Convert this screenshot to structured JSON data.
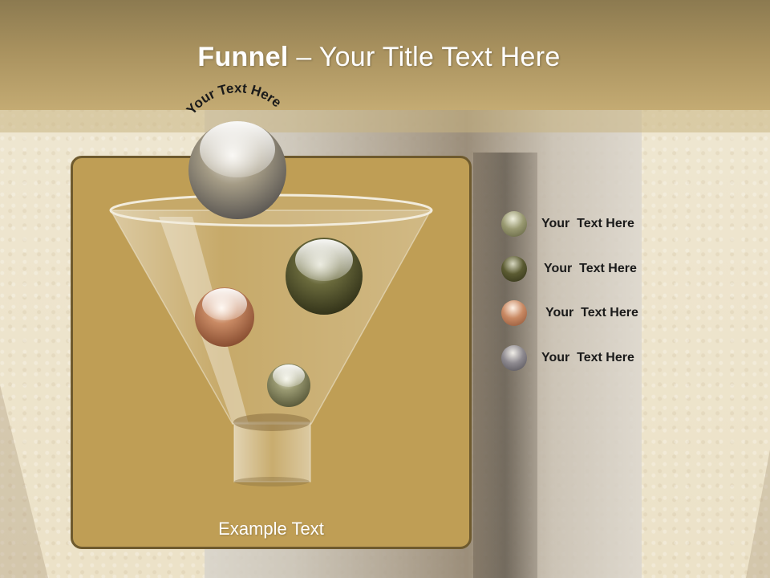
{
  "slide": {
    "title_bold": "Funnel",
    "title_rest": " – Your Title Text Here",
    "arc_label": "Your Text Here",
    "example_text": "Example Text"
  },
  "legend": [
    {
      "label": "Your  Text Here",
      "ball": "olive-ball-icon",
      "color": "#8a8a62"
    },
    {
      "label": "Your  Text Here",
      "ball": "dark-olive-ball-icon",
      "color": "#4f4f2c"
    },
    {
      "label": "Your  Text Here",
      "ball": "copper-ball-icon",
      "color": "#b8734c"
    },
    {
      "label": "Your  Text Here",
      "ball": "grey-ball-icon",
      "color": "#75737a"
    }
  ],
  "colors": {
    "panel": "#bf9e55",
    "header": "#a8915e",
    "silver_ball": "#8f8a7c"
  }
}
